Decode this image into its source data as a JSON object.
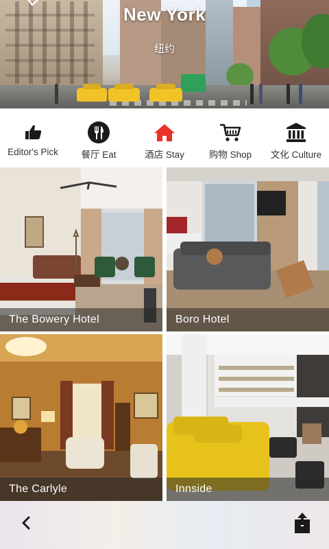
{
  "header": {
    "title": "New York",
    "subtitle": "纽约"
  },
  "categories": [
    {
      "label": "Editor's Pick",
      "icon": "thumbs-up-icon"
    },
    {
      "label": "餐厅 Eat",
      "icon": "fork-knife-icon"
    },
    {
      "label": "酒店 Stay",
      "icon": "house-icon",
      "active": true
    },
    {
      "label": "购物 Shop",
      "icon": "shopping-cart-icon"
    },
    {
      "label": "文化 Culture",
      "icon": "museum-icon"
    }
  ],
  "hotels": [
    {
      "name": "The Bowery Hotel"
    },
    {
      "name": "Boro Hotel"
    },
    {
      "name": "The Carlyle"
    },
    {
      "name": "Innside"
    }
  ],
  "colors": {
    "active_icon": "#e8322a",
    "icon": "#1a1a1a",
    "caption_bg": "#282828"
  },
  "bottom_bar": {
    "back_icon": "chevron-left-icon",
    "share_icon": "share-icon"
  }
}
